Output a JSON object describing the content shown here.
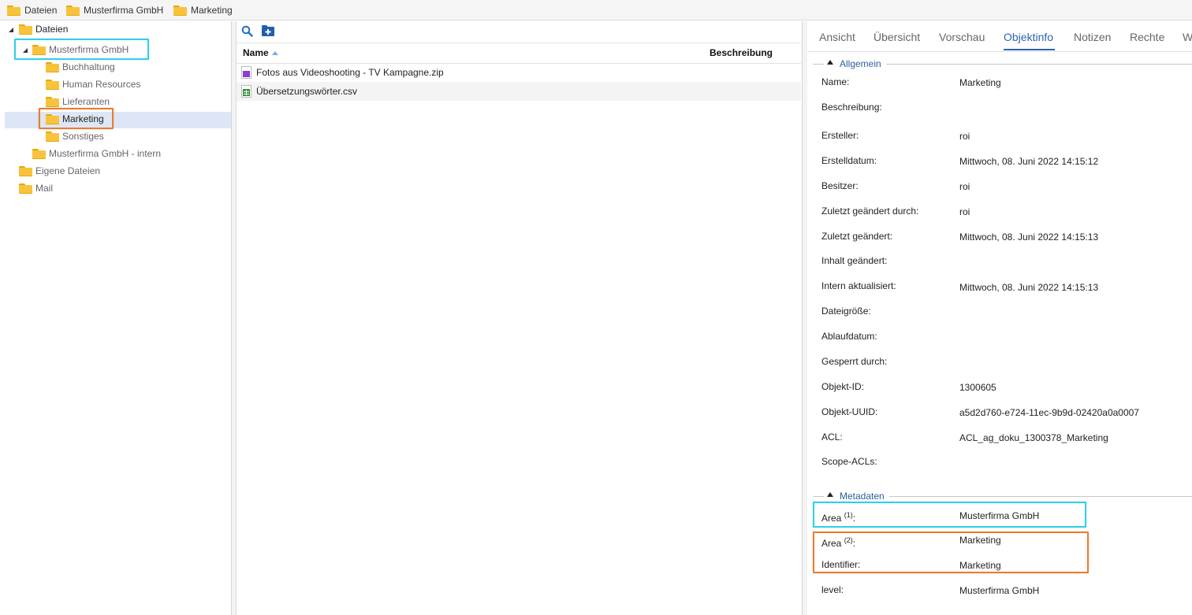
{
  "breadcrumb": [
    "Dateien",
    "Musterfirma GmbH",
    "Marketing"
  ],
  "tree": {
    "root": "Dateien",
    "company": "Musterfirma GmbH",
    "children": [
      "Buchhaltung",
      "Human Resources",
      "Lieferanten",
      "Marketing",
      "Sonstiges"
    ],
    "intern": "Musterfirma GmbH - intern",
    "own_files": "Eigene Dateien",
    "mail": "Mail"
  },
  "files": {
    "col_name": "Name",
    "col_desc": "Beschreibung",
    "rows": [
      "Fotos aus Videoshooting - TV Kampagne.zip",
      "Übersetzungswörter.csv"
    ]
  },
  "tabs": [
    "Ansicht",
    "Übersicht",
    "Vorschau",
    "Objektinfo",
    "Notizen",
    "Rechte",
    "W"
  ],
  "general": {
    "section": "Allgemein",
    "fields": [
      {
        "label": "Name:",
        "value": "Marketing"
      },
      {
        "label": "Beschreibung:",
        "value": ""
      },
      {
        "label": "Ersteller:",
        "value": "roi"
      },
      {
        "label": "Erstelldatum:",
        "value": "Mittwoch, 08. Juni 2022 14:15:12"
      },
      {
        "label": "Besitzer:",
        "value": "roi"
      },
      {
        "label": "Zuletzt geändert durch:",
        "value": "roi"
      },
      {
        "label": "Zuletzt geändert:",
        "value": "Mittwoch, 08. Juni 2022 14:15:13"
      },
      {
        "label": "Inhalt geändert:",
        "value": ""
      },
      {
        "label": "Intern aktualisiert:",
        "value": "Mittwoch, 08. Juni 2022 14:15:13"
      },
      {
        "label": "Dateigröße:",
        "value": ""
      },
      {
        "label": "Ablaufdatum:",
        "value": ""
      },
      {
        "label": "Gesperrt durch:",
        "value": ""
      },
      {
        "label": "Objekt-ID:",
        "value": "1300605"
      },
      {
        "label": "Objekt-UUID:",
        "value": "a5d2d760-e724-11ec-9b9d-02420a0a0007"
      },
      {
        "label": "ACL:",
        "value": "ACL_ag_doku_1300378_Marketing"
      },
      {
        "label": "Scope-ACLs:",
        "value": ""
      }
    ]
  },
  "metadata": {
    "section": "Metadaten",
    "area1_label": "Area",
    "area1_sup": "(1)",
    "area1_value": "Musterfirma GmbH",
    "area2_label": "Area",
    "area2_sup": "(2)",
    "area2_value": "Marketing",
    "identifier_label": "Identifier:",
    "identifier_value": "Marketing",
    "level_label": "level:",
    "level_value": "Musterfirma GmbH"
  },
  "colors": {
    "highlight_cyan": "#2fd0ee",
    "highlight_orange": "#ef7b2a",
    "accent": "#2c65b1"
  }
}
